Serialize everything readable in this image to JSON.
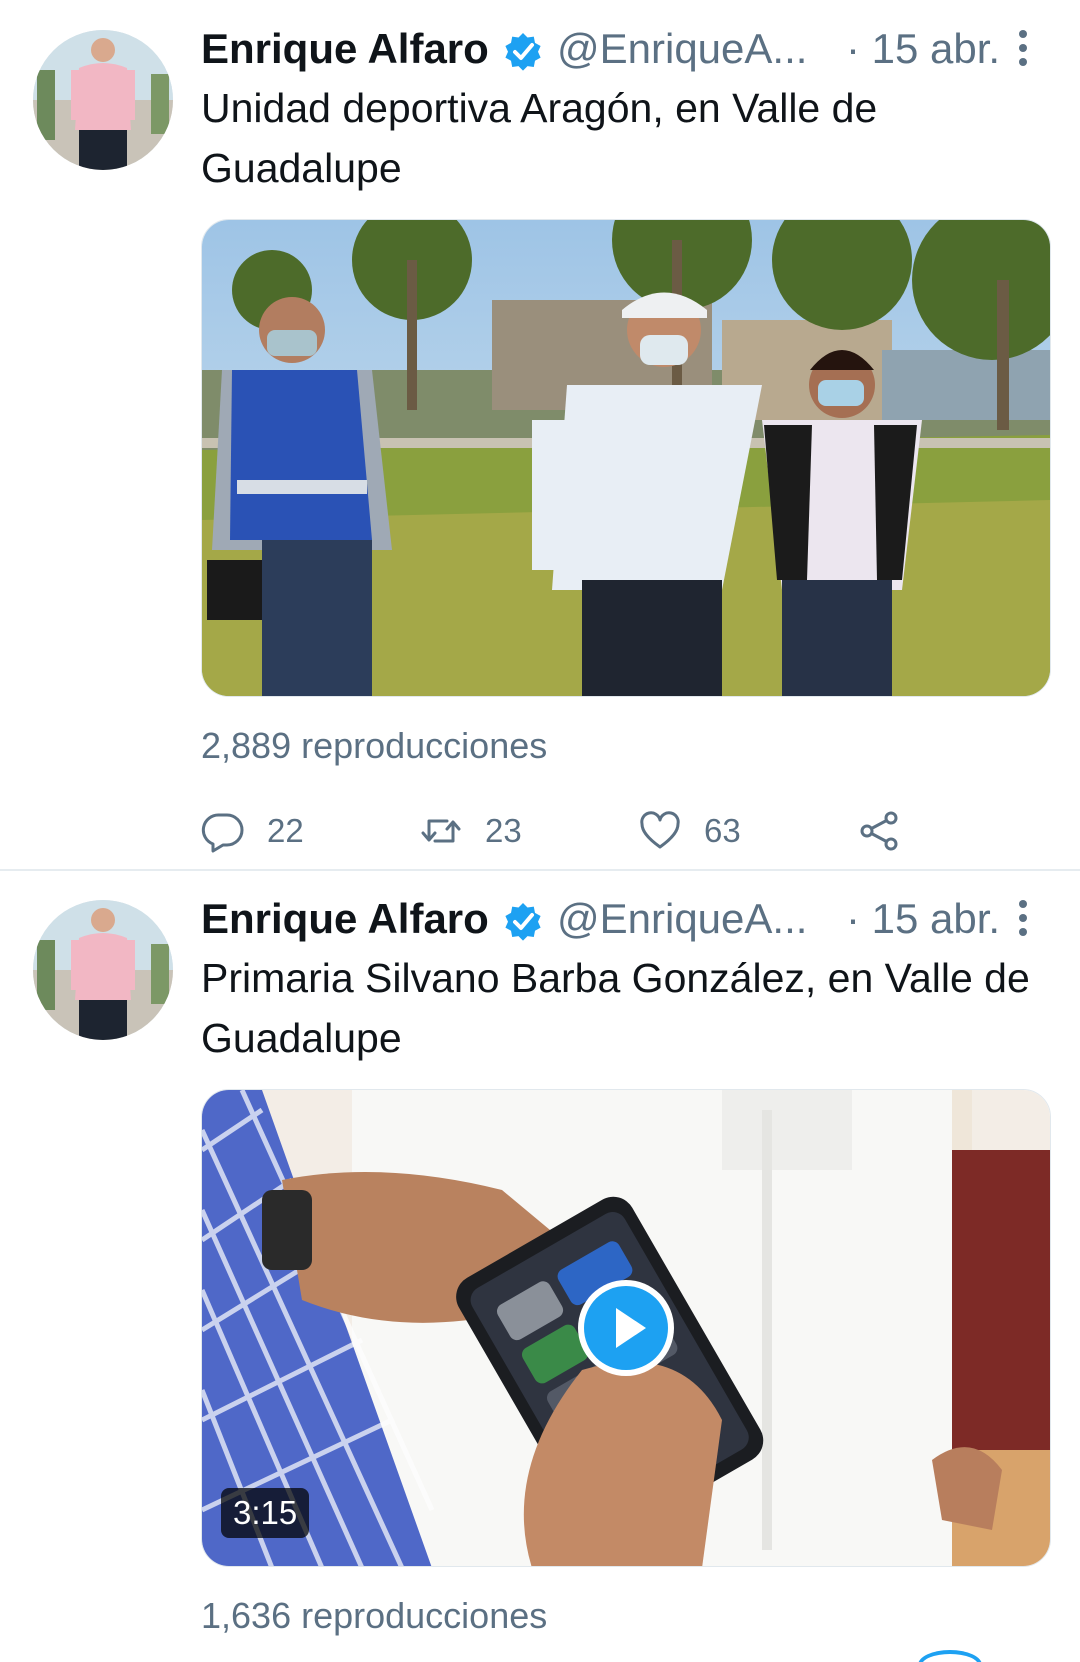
{
  "tweets": [
    {
      "author_name": "Enrique Alfaro",
      "handle": "@EnriqueA...",
      "date": "· 15 abr.",
      "text": "Unidad deportiva Aragón, en Valle de Guadalupe",
      "views": "2,889 reproducciones",
      "reply_count": "22",
      "retweet_count": "23",
      "like_count": "63"
    },
    {
      "author_name": "Enrique Alfaro",
      "handle": "@EnriqueA...",
      "date": "· 15 abr.",
      "text": "Primaria Silvano Barba González, en Valle de Guadalupe",
      "video_duration": "3:15",
      "views": "1,636 reproducciones"
    }
  ],
  "icons": {
    "verified": "verified-badge-icon",
    "more": "more-vertical-icon",
    "reply": "reply-icon",
    "retweet": "retweet-icon",
    "like": "heart-icon",
    "share": "share-icon",
    "play": "play-icon"
  },
  "colors": {
    "accent": "#1da1f2",
    "secondary_text": "#5b7083",
    "primary_text": "#0f1419"
  }
}
